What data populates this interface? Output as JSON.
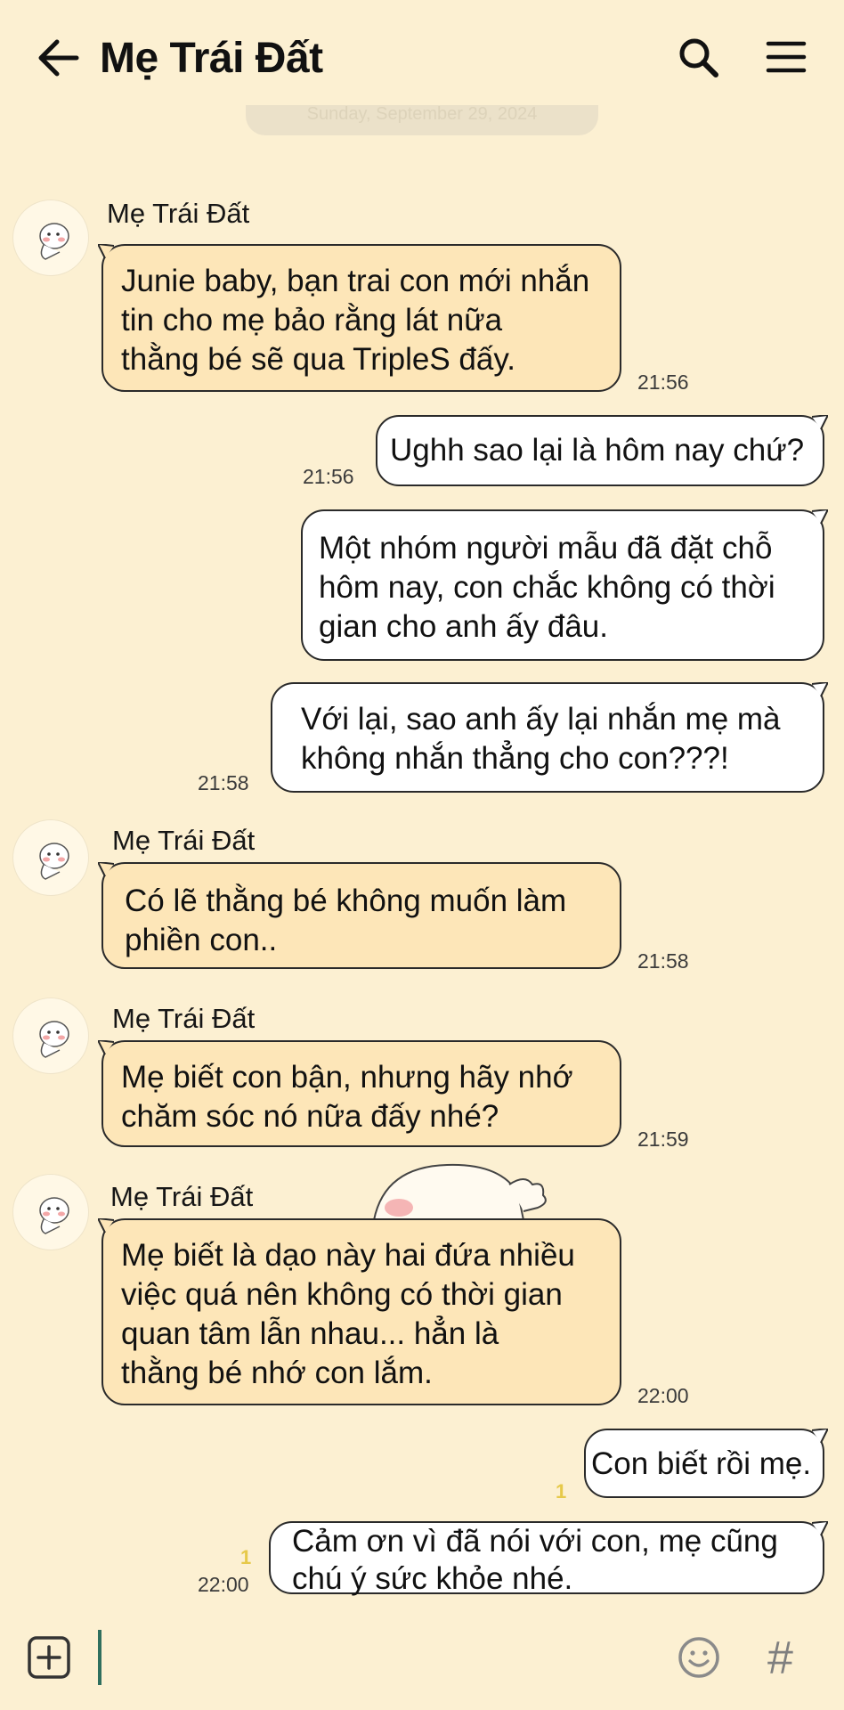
{
  "header": {
    "title": "Mẹ Trái Đất",
    "back_icon": "arrow-left-icon",
    "search_icon": "search-icon",
    "menu_icon": "hamburger-menu-icon"
  },
  "date_separator": "Sunday, September 29, 2024",
  "messages": [
    {
      "sender": "Mẹ Trái Đất",
      "text": "Junie baby, bạn trai con mới nhắn\ntin cho mẹ bảo rằng lát nữa\nthằng bé sẽ qua TripleS đấy.",
      "time": "21:56"
    },
    {
      "text": "Ughh sao lại là hôm nay chứ?",
      "time": "21:56"
    },
    {
      "text": "Một nhóm người mẫu đã đặt chỗ\nhôm nay, con chắc không có thời\ngian cho anh ấy đâu."
    },
    {
      "text": "Với lại, sao anh ấy lại nhắn mẹ mà\nkhông nhắn thẳng cho con???!",
      "time": "21:58"
    },
    {
      "sender": "Mẹ Trái Đất",
      "text": "Có lẽ thằng bé không muốn làm\nphiền con..",
      "time": "21:58"
    },
    {
      "sender": "Mẹ Trái Đất",
      "text": "Mẹ biết con bận, nhưng hãy nhớ\nchăm sóc nó nữa đấy nhé?",
      "time": "21:59"
    },
    {
      "sender": "Mẹ Trái Đất",
      "text": "Mẹ biết là dạo này hai đứa nhiều\nviệc quá nên không có thời gian\nquan tâm lẫn nhau... hẳn là\nthằng bé nhớ con lắm.",
      "time": "22:00"
    },
    {
      "text": "Con biết rồi mẹ.",
      "read": "1"
    },
    {
      "text": "Cảm ơn vì đã nói với con, mẹ cũng\nchú ý sức khỏe nhé.",
      "time": "22:00",
      "read": "1"
    }
  ],
  "input_bar": {
    "add_icon": "plus-square-icon",
    "emoji_icon": "smiley-icon",
    "hash_label": "#"
  },
  "colors": {
    "background": "#fcf0d2",
    "incoming_bubble": "#fde6b8",
    "outgoing_bubble": "#ffffff",
    "read_marker": "#e6c94a"
  }
}
